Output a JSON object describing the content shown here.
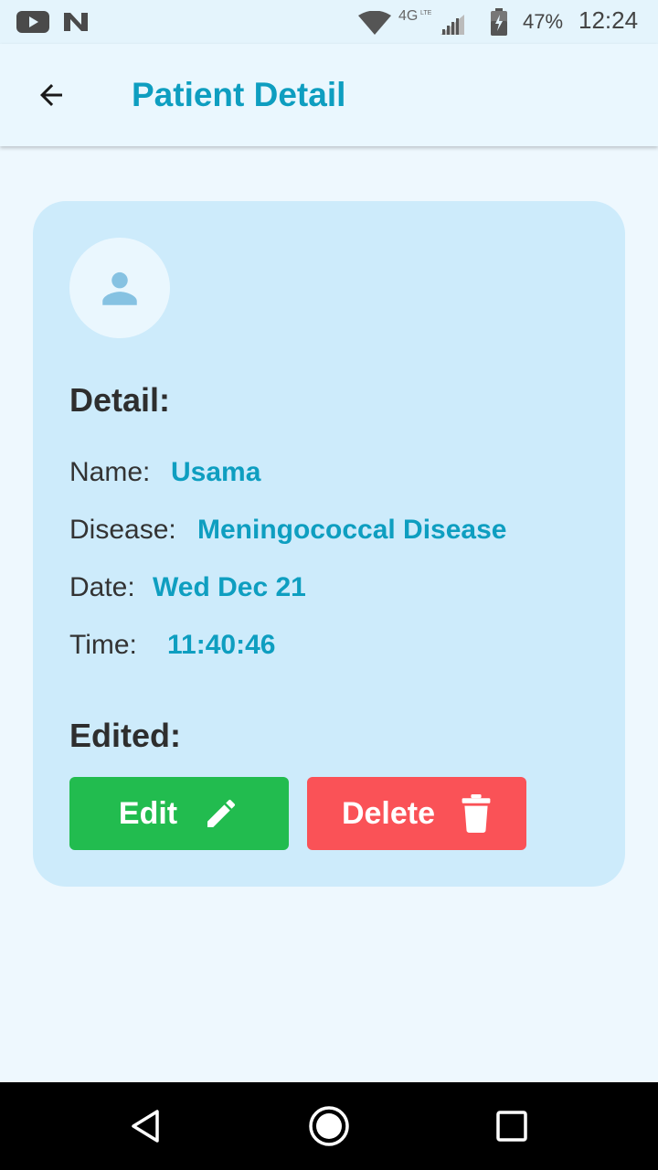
{
  "status_bar": {
    "battery": "47%",
    "time": "12:24",
    "network": "4G LTE",
    "icons": [
      "youtube-icon",
      "n-app-icon",
      "wifi-icon",
      "cell-signal-icon",
      "battery-icon"
    ]
  },
  "app_bar": {
    "title": "Patient Detail",
    "back_icon": "arrow-left-icon"
  },
  "card": {
    "avatar_icon": "person-icon",
    "detail_heading": "Detail:",
    "fields": [
      {
        "label": "Name:",
        "value": "Usama"
      },
      {
        "label": "Disease:",
        "value": "Meningococcal Disease"
      },
      {
        "label": "Date:",
        "value": "Wed Dec 21"
      },
      {
        "label": "Time:",
        "value": "11:40:46"
      }
    ],
    "edited_heading": "Edited:",
    "edit_button": {
      "label": "Edit",
      "icon": "pencil-icon"
    },
    "delete_button": {
      "label": "Delete",
      "icon": "trash-icon"
    }
  },
  "nav_bar": {
    "icons": [
      "back-triangle-icon",
      "home-circle-icon",
      "recents-square-icon"
    ]
  },
  "colors": {
    "accent": "#0e9ec0",
    "card_bg": "#cdebfb",
    "page_bg": "#eef8fe",
    "edit_green": "#22bc4f",
    "delete_red": "#fa5257"
  }
}
